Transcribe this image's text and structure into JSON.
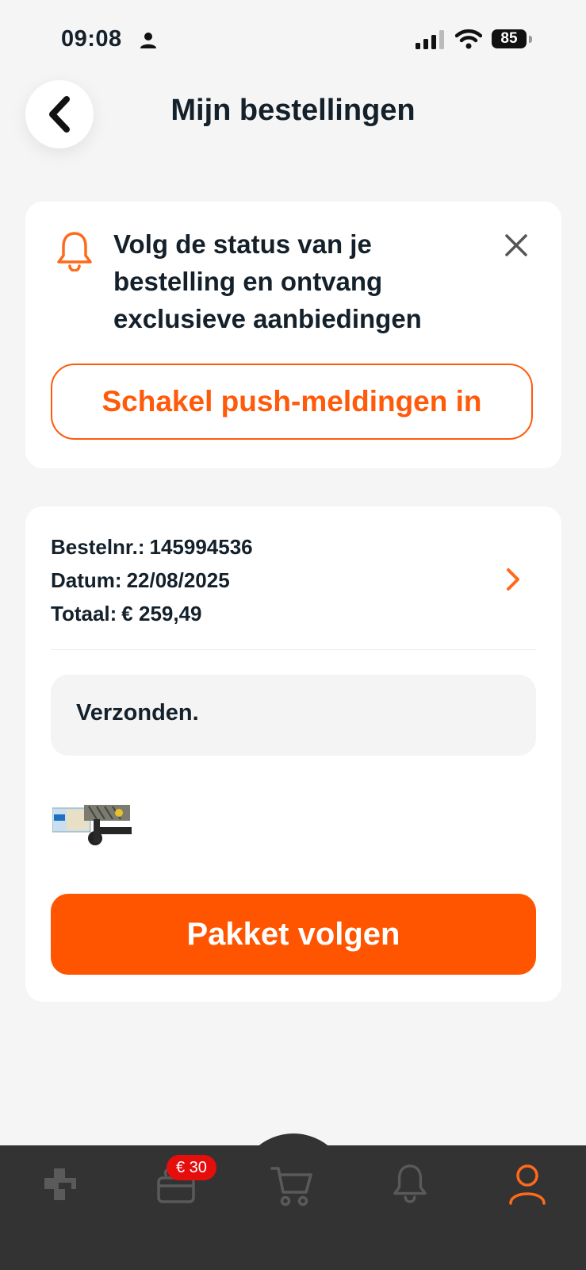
{
  "status_bar": {
    "time": "09:08",
    "battery": "85"
  },
  "header": {
    "title": "Mijn bestellingen"
  },
  "push_card": {
    "message": "Volg de status van je bestelling en ontvang exclusieve aanbiedingen",
    "button_label": "Schakel push-meldingen in"
  },
  "order": {
    "number_label": "Bestelnr.:",
    "number": "145994536",
    "date_label": "Datum:",
    "date": "22/08/2025",
    "total_label": "Totaal:",
    "total": "€ 259,49",
    "status": "Verzonden.",
    "track_button_label": "Pakket volgen"
  },
  "bottom_nav": {
    "badge": "€ 30",
    "items": [
      "home-icon",
      "gift-icon",
      "cart-icon",
      "bell-icon",
      "account-icon"
    ],
    "active_color": "#ff6a1a",
    "inactive_color": "#5a5a5a"
  },
  "colors": {
    "accent": "#ff5500",
    "background": "#f5f5f5"
  }
}
